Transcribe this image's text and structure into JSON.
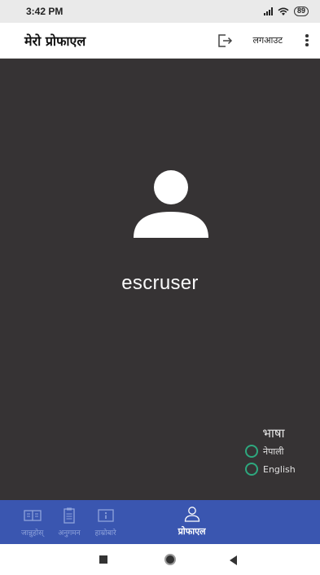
{
  "status_bar": {
    "time": "3:42 PM",
    "battery": "89"
  },
  "app_bar": {
    "title": "मेरो प्रोफाएल",
    "logout_label": "लगआउट"
  },
  "profile": {
    "username": "escruser"
  },
  "language": {
    "title": "भाषा",
    "options": [
      "नेपाली",
      "English"
    ],
    "accent_color": "#2ea87e"
  },
  "bottom_nav": {
    "items": [
      {
        "label": "जान्नुहोस्",
        "icon": "book-icon"
      },
      {
        "label": "अनुगमन",
        "icon": "clipboard-icon"
      },
      {
        "label": "हाम्रोबारे",
        "icon": "info-icon"
      },
      {
        "label": "प्रोफाएल",
        "icon": "person-icon",
        "active": true
      }
    ],
    "background": "#3a56b0"
  },
  "colors": {
    "content_background": "#363334",
    "app_bar_background": "#ffffff"
  }
}
